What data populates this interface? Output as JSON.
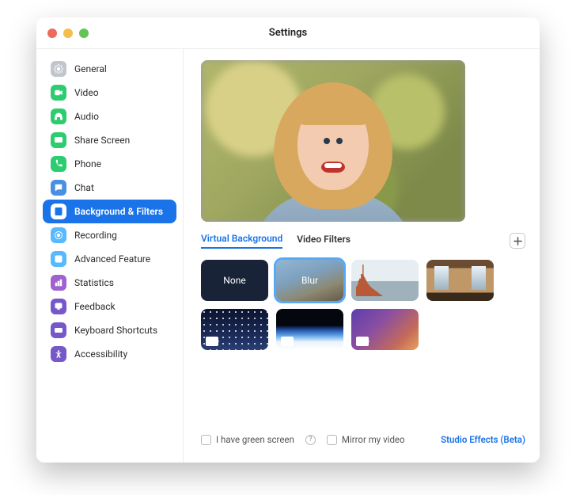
{
  "window": {
    "title": "Settings"
  },
  "sidebar": {
    "items": [
      {
        "id": "general",
        "label": "General",
        "icon": "gear",
        "color": "#c1c6cc"
      },
      {
        "id": "video",
        "label": "Video",
        "icon": "video",
        "color": "#2ecc71"
      },
      {
        "id": "audio",
        "label": "Audio",
        "icon": "headphones",
        "color": "#2ecc71"
      },
      {
        "id": "share-screen",
        "label": "Share Screen",
        "icon": "share",
        "color": "#2ecc71"
      },
      {
        "id": "phone",
        "label": "Phone",
        "icon": "phone",
        "color": "#2ecc71"
      },
      {
        "id": "chat",
        "label": "Chat",
        "icon": "chat",
        "color": "#4a90e2"
      },
      {
        "id": "background-filters",
        "label": "Background & Filters",
        "icon": "portrait",
        "color": "#1a73e8",
        "active": true
      },
      {
        "id": "recording",
        "label": "Recording",
        "icon": "record",
        "color": "#58b9ff"
      },
      {
        "id": "advanced-feature",
        "label": "Advanced Feature",
        "icon": "plus-square",
        "color": "#58b9ff"
      },
      {
        "id": "statistics",
        "label": "Statistics",
        "icon": "stats",
        "color": "#a162d1"
      },
      {
        "id": "feedback",
        "label": "Feedback",
        "icon": "feedback",
        "color": "#7658c9"
      },
      {
        "id": "keyboard-shortcuts",
        "label": "Keyboard Shortcuts",
        "icon": "keyboard",
        "color": "#7658c9"
      },
      {
        "id": "accessibility",
        "label": "Accessibility",
        "icon": "accessibility",
        "color": "#7658c9"
      }
    ]
  },
  "tabs": {
    "virtual": "Virtual Background",
    "filters": "Video Filters",
    "active": "virtual"
  },
  "add_button": {
    "title": "Add Image or Video"
  },
  "backgrounds": [
    {
      "id": "none",
      "label": "None",
      "type": "none"
    },
    {
      "id": "blur",
      "label": "Blur",
      "type": "blur",
      "selected": true
    },
    {
      "id": "bridge",
      "label": "",
      "type": "image"
    },
    {
      "id": "room",
      "label": "",
      "type": "image"
    },
    {
      "id": "stars",
      "label": "",
      "type": "video"
    },
    {
      "id": "earth",
      "label": "",
      "type": "video"
    },
    {
      "id": "gradient",
      "label": "",
      "type": "video"
    }
  ],
  "footer": {
    "green_screen": {
      "label": "I have green screen",
      "checked": false
    },
    "mirror": {
      "label": "Mirror my video",
      "checked": false
    },
    "studio": "Studio Effects (Beta)"
  }
}
